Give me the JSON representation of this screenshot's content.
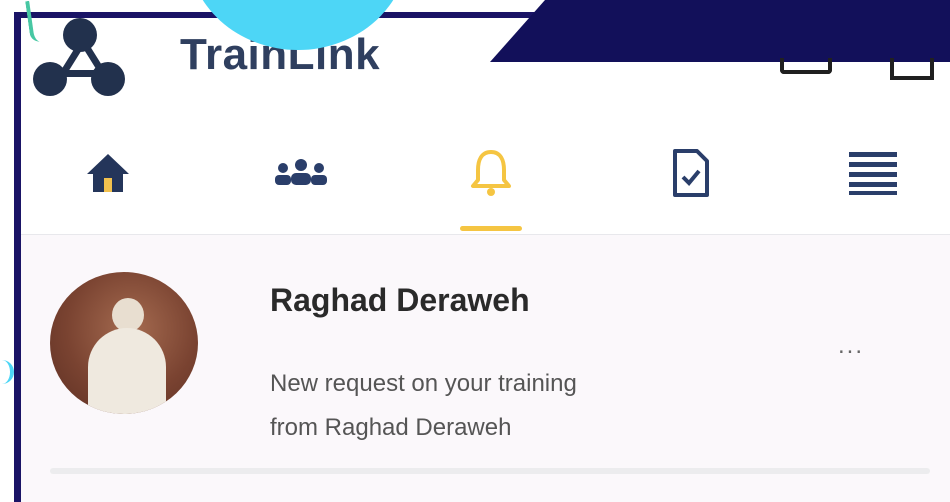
{
  "app": {
    "title": "TrainLink"
  },
  "colors": {
    "frame": "#1a1466",
    "banner": "#12105a",
    "accent_cyan": "#4dd6f6",
    "tab_active": "#f5c542",
    "logo": "#22314d"
  },
  "tabs": [
    {
      "icon": "home-icon",
      "active": false
    },
    {
      "icon": "people-group-icon",
      "active": false
    },
    {
      "icon": "bell-icon",
      "active": true
    },
    {
      "icon": "document-check-icon",
      "active": false
    },
    {
      "icon": "menu-icon",
      "active": false
    }
  ],
  "notification": {
    "name": "Raghad Deraweh",
    "message_line1": "New request on your training",
    "message_line2": "from Raghad Deraweh",
    "more_label": "..."
  }
}
